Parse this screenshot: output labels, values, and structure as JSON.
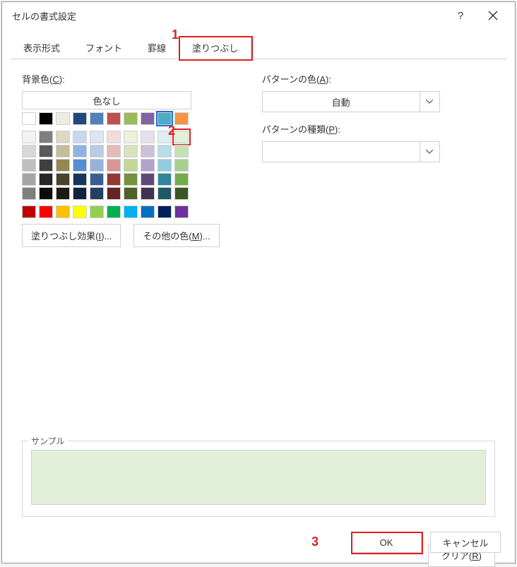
{
  "window": {
    "title": "セルの書式設定"
  },
  "tabs": {
    "display": "表示形式",
    "font": "フォント",
    "border": "罫線",
    "fill": "塗りつぶし"
  },
  "labels": {
    "background": "背景色",
    "background_accel": "(C)",
    "no_color": "色なし",
    "pattern_color": "パターンの色",
    "pattern_color_accel": "(A)",
    "pattern_type": "パターンの種類",
    "pattern_type_accel": "(P)",
    "auto": "自動",
    "fill_effects": "塗りつぶし効果",
    "fill_effects_accel": "(I)",
    "more_colors": "その他の色",
    "more_colors_accel": "(M)",
    "sample": "サンプル",
    "clear": "クリア",
    "clear_accel": "(R)",
    "ok": "OK",
    "cancel": "キャンセル"
  },
  "swatches_row1": [
    "#ffffff",
    "#000000",
    "#eeece1",
    "#1f497d",
    "#4f81bd",
    "#c0504d",
    "#9bbb59",
    "#8064a2",
    "#4bacc6",
    "#f79646"
  ],
  "swatches_grid": [
    [
      "#f2f2f2",
      "#7f7f7f",
      "#ddd9c3",
      "#c6d9f0",
      "#dbe5f1",
      "#f2dcdb",
      "#ebf1dd",
      "#e5e0ec",
      "#dbeef3",
      "#e2efd9"
    ],
    [
      "#d8d8d8",
      "#595959",
      "#c4bd97",
      "#8db3e2",
      "#b8cce4",
      "#e5b9b7",
      "#d7e3bc",
      "#ccc1d9",
      "#b7dde8",
      "#c5e0b3"
    ],
    [
      "#bfbfbf",
      "#3f3f3f",
      "#938953",
      "#548dd4",
      "#95b3d7",
      "#d99694",
      "#c3d69b",
      "#b2a2c7",
      "#92cddc",
      "#a8d08d"
    ],
    [
      "#a5a5a5",
      "#262626",
      "#494429",
      "#17365d",
      "#366092",
      "#953734",
      "#76923c",
      "#5f497a",
      "#31859b",
      "#70ad47"
    ],
    [
      "#7f7f7f",
      "#0c0c0c",
      "#1d1b10",
      "#0f243e",
      "#244061",
      "#632423",
      "#4f6128",
      "#3f3151",
      "#205867",
      "#385723"
    ]
  ],
  "swatches_std": [
    "#c00000",
    "#ff0000",
    "#ffc000",
    "#ffff00",
    "#92d050",
    "#00b050",
    "#00b0f0",
    "#0070c0",
    "#002060",
    "#7030a0"
  ],
  "sample_color": "#e2efd9",
  "annotations": {
    "a1": "1",
    "a2": "2",
    "a3": "3"
  }
}
